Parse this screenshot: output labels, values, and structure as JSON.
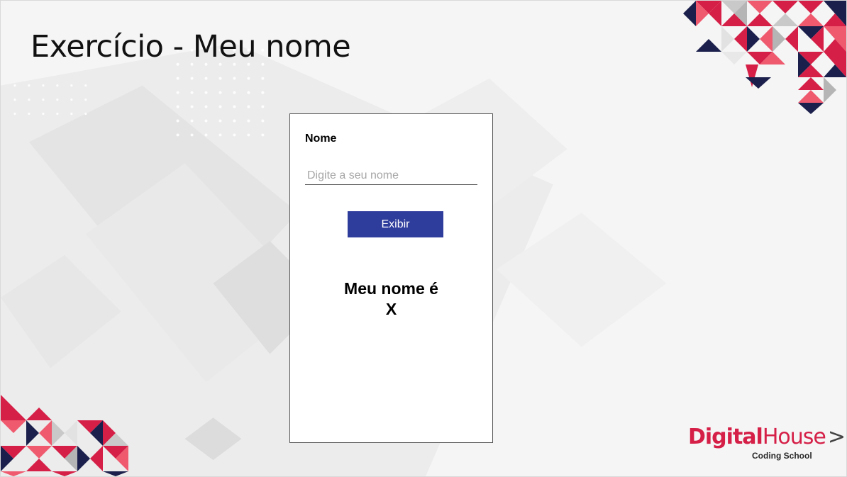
{
  "slide": {
    "title": "Exercício - Meu nome"
  },
  "form": {
    "label": "Nome",
    "input_value": "",
    "input_placeholder": "Digite a seu nome",
    "button_label": "Exibir",
    "result_line1": "Meu nome é",
    "result_line2": "X"
  },
  "logo": {
    "brand_part1": "Digital",
    "brand_part2": "House",
    "brand_chevron": ">",
    "tagline": "Coding School"
  },
  "colors": {
    "button": "#2e3c9c",
    "brand_red": "#d51f47",
    "brand_navy": "#1b1f4b"
  }
}
